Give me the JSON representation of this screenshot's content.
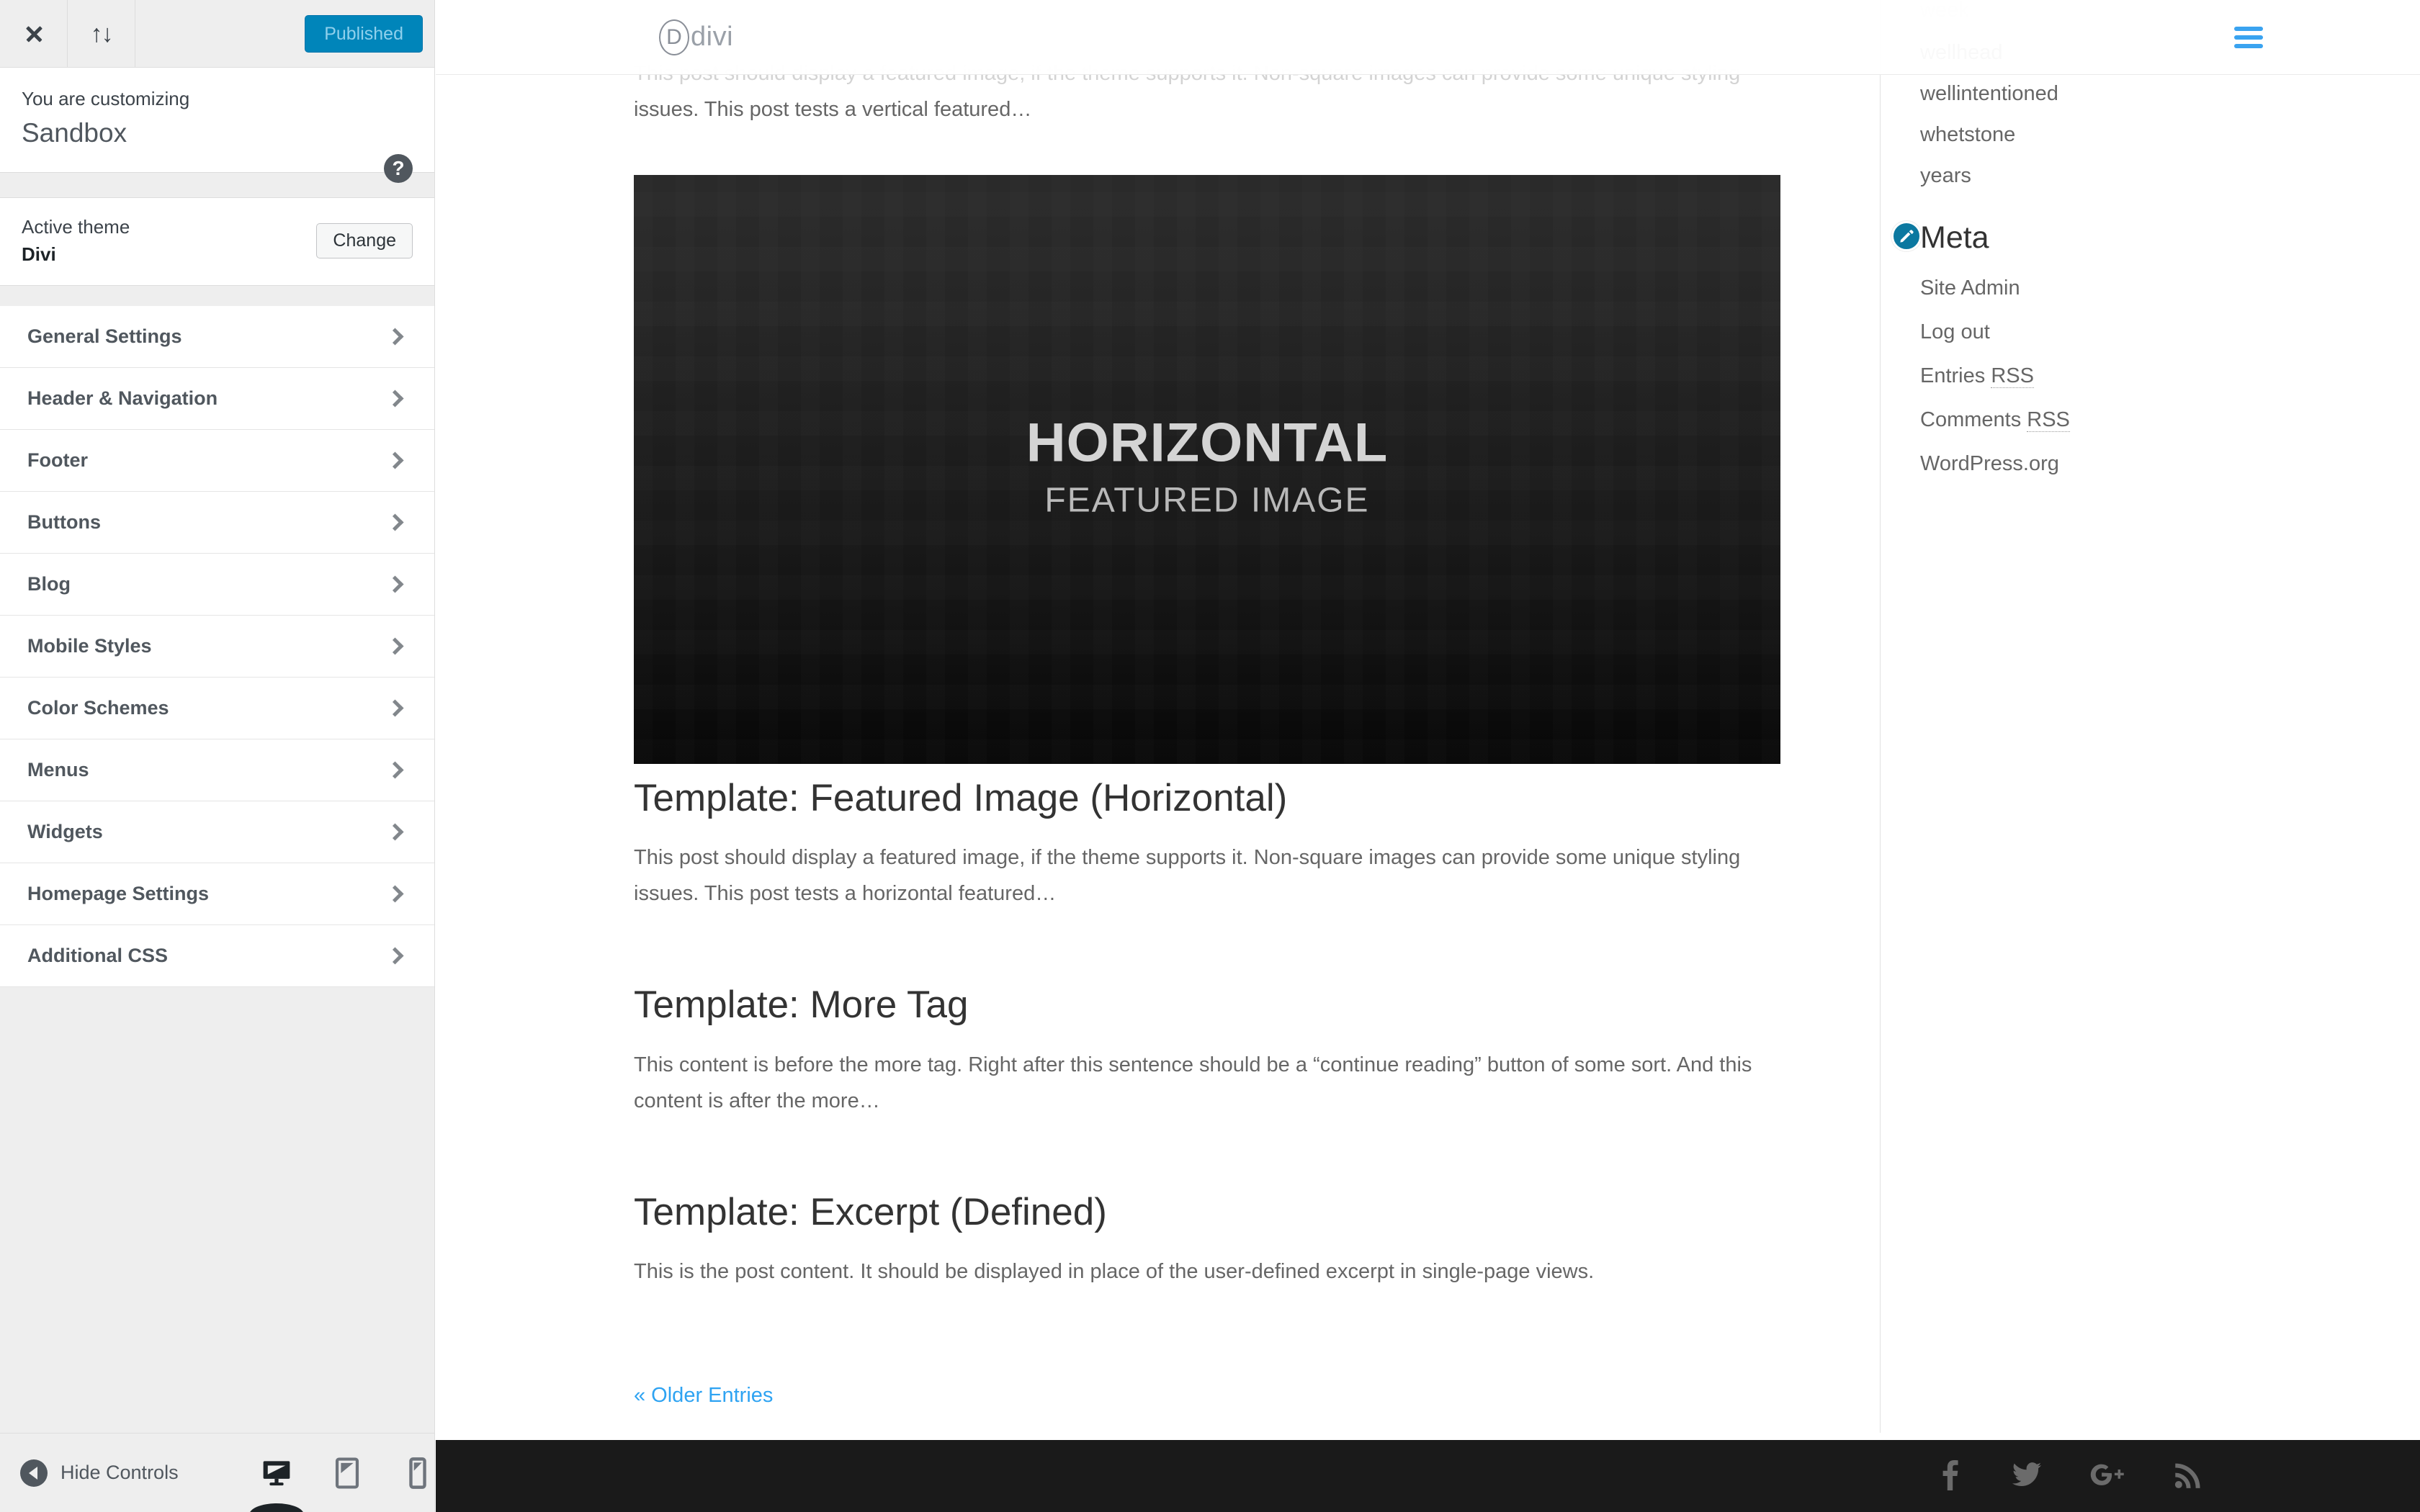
{
  "customizer": {
    "topbar": {
      "close_icon": "close-icon",
      "collapse_icon": "up-down-arrows-icon",
      "publish_label": "Published"
    },
    "info": {
      "customizing_label": "You are customizing",
      "site_title": "Sandbox",
      "help_icon": "?"
    },
    "theme": {
      "active_theme_label": "Active theme",
      "theme_name": "Divi",
      "change_label": "Change"
    },
    "sections": [
      {
        "label": "General Settings"
      },
      {
        "label": "Header & Navigation"
      },
      {
        "label": "Footer"
      },
      {
        "label": "Buttons"
      },
      {
        "label": "Blog"
      },
      {
        "label": "Mobile Styles"
      },
      {
        "label": "Color Schemes"
      },
      {
        "label": "Menus"
      },
      {
        "label": "Widgets"
      },
      {
        "label": "Homepage Settings"
      },
      {
        "label": "Additional CSS"
      }
    ],
    "bottom": {
      "hide_controls_label": "Hide Controls",
      "devices": [
        {
          "name": "desktop",
          "active": true
        },
        {
          "name": "tablet",
          "active": false
        },
        {
          "name": "mobile",
          "active": false
        }
      ]
    },
    "colors": {
      "publish_blue": "#0085ba",
      "panel_bg": "#eeeeee",
      "text": "#50575e"
    }
  },
  "preview": {
    "header": {
      "logo_letter": "D",
      "logo_word": "divi",
      "menu_icon": "hamburger-menu-icon",
      "menu_color": "#3aa3f0"
    },
    "posts": [
      {
        "partial_excerpt_top": "This post should display a featured image, if the theme supports it. Non-square images can provide some unique styling",
        "partial_excerpt_visible": "issues. This post tests a vertical featured…"
      },
      {
        "featured_image": {
          "line1": "HORIZONTAL",
          "line2": "FEATURED IMAGE"
        },
        "title": "Template: Featured Image (Horizontal)",
        "excerpt": "This post should display a featured image, if the theme supports it. Non-square images can provide some unique styling issues. This post tests a horizontal featured…"
      },
      {
        "title": "Template: More Tag",
        "excerpt": "This content is before the more tag. Right after this sentence should be a “continue reading” button of some sort. And this content is after the more…"
      },
      {
        "title": "Template: Excerpt (Defined)",
        "excerpt": "This is the post content. It should be displayed in place of the user-defined excerpt in single-page views."
      }
    ],
    "pagination": {
      "older_entries_label": "« Older Entries",
      "link_color": "#2ea3f2"
    },
    "sidebar": {
      "tag_cloud": [
        {
          "label": "week",
          "clipped": true
        },
        {
          "label": "wellhead",
          "clipped": false
        },
        {
          "label": "wellintentioned",
          "clipped": false
        },
        {
          "label": "whetstone",
          "clipped": false
        },
        {
          "label": "years",
          "clipped": false
        }
      ],
      "meta_widget": {
        "title": "Meta",
        "edit_icon": "pencil-edit-icon",
        "edit_icon_color": "#0b78a0",
        "links": [
          {
            "text": "Site Admin",
            "abbr": ""
          },
          {
            "text": "Log out",
            "abbr": ""
          },
          {
            "text": "Entries ",
            "abbr": "RSS"
          },
          {
            "text": "Comments ",
            "abbr": "RSS"
          },
          {
            "text": "WordPress.org",
            "abbr": ""
          }
        ]
      }
    },
    "footer": {
      "background": "#1a1a1a",
      "social": [
        {
          "name": "facebook-icon"
        },
        {
          "name": "twitter-icon"
        },
        {
          "name": "google-plus-icon"
        },
        {
          "name": "rss-icon"
        }
      ]
    }
  }
}
